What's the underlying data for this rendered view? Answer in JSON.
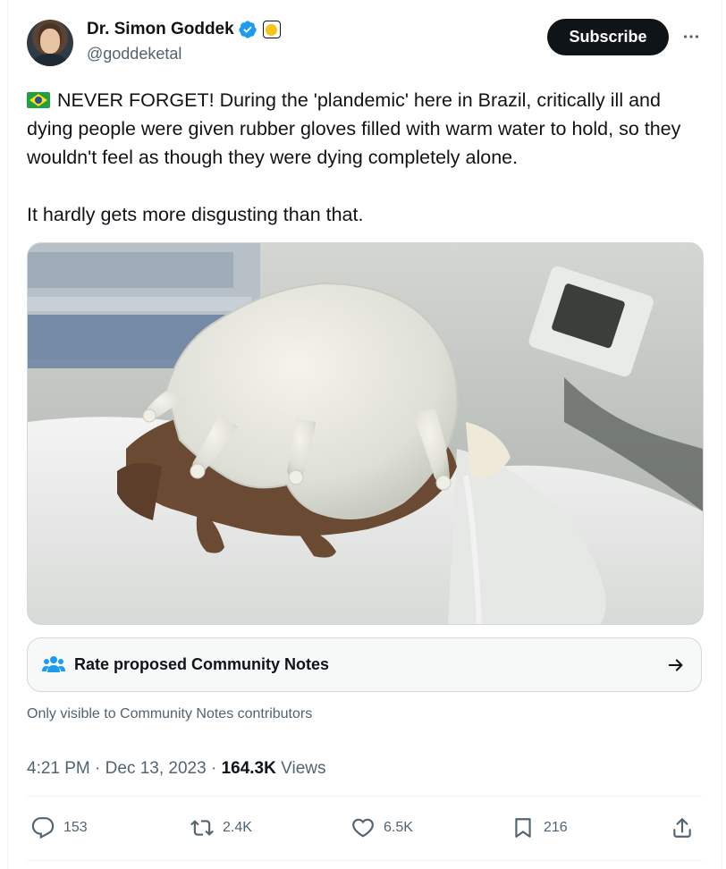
{
  "author": {
    "name": "Dr. Simon Goddek",
    "handle": "@goddeketal",
    "verified_icon": "verified-badge-icon",
    "affiliation_icon": "affiliation-badge-icon"
  },
  "header": {
    "subscribe_label": "Subscribe",
    "more_icon": "more-horizontal-icon"
  },
  "tweet": {
    "flag_icon": "brazil-flag-icon",
    "text": "NEVER FORGET! During the 'plandemic' here in Brazil, critically ill and dying people were given rubber gloves filled with warm water to hold, so they wouldn't feel as though they were dying completely alone.\n\nIt hardly gets more disgusting than that."
  },
  "community_notes": {
    "label": "Rate proposed Community Notes",
    "visibility": "Only visible to Community Notes contributors"
  },
  "meta": {
    "time": "4:21 PM",
    "sep1": " · ",
    "date": "Dec 13, 2023",
    "sep2": " · ",
    "views_count": "164.3K",
    "views_label": " Views"
  },
  "actions": {
    "replies": "153",
    "reposts": "2.4K",
    "likes": "6.5K",
    "bookmarks": "216"
  },
  "colors": {
    "text": "#0f1419",
    "secondary": "#536471",
    "verified": "#1d9bf0",
    "border": "#cfd9de"
  }
}
